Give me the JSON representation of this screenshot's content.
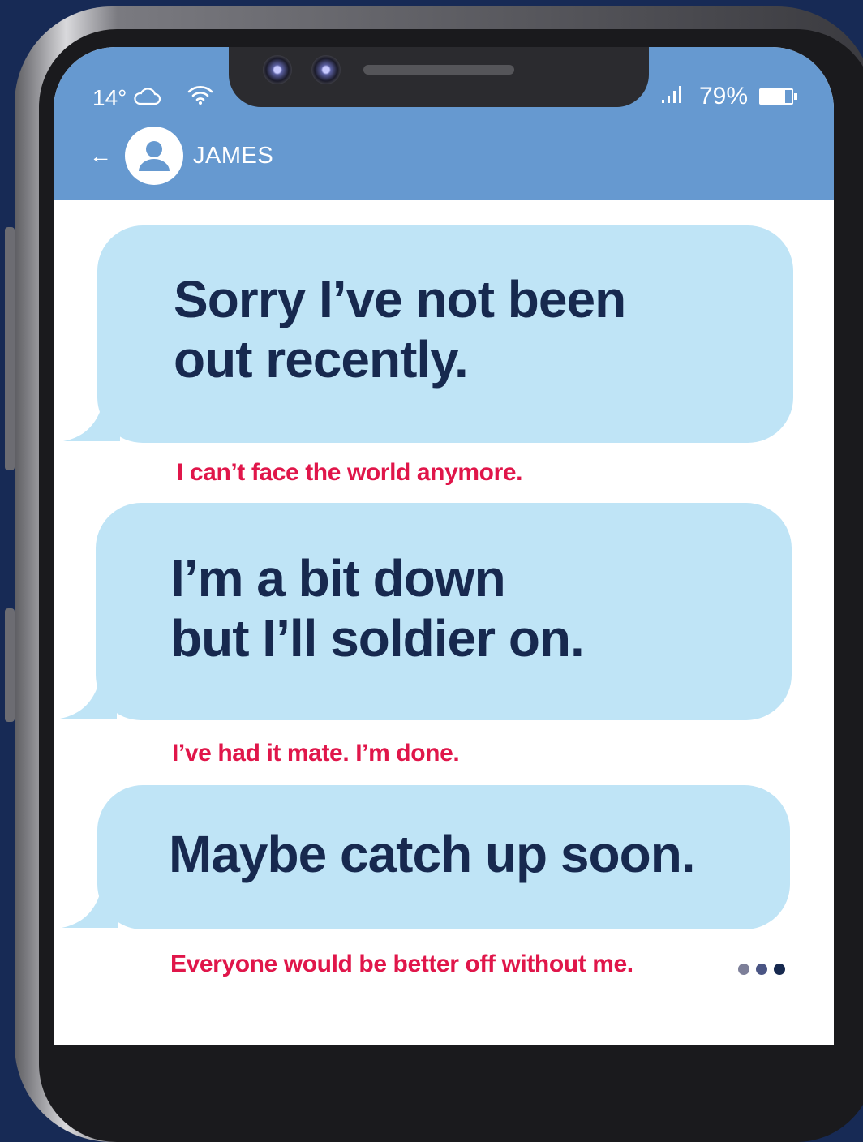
{
  "status": {
    "temperature": "14°",
    "weather_icon": "cloud-icon",
    "wifi_icon": "wifi-icon",
    "signal_icon": "signal-bars-icon",
    "battery_percent": "79%",
    "battery_level": 0.79
  },
  "header": {
    "contact_name": "JAMES",
    "back_icon": "back-arrow-icon",
    "avatar_icon": "user-avatar-icon"
  },
  "messages": [
    {
      "line1": "Sorry I’ve not been",
      "line2": "out recently.",
      "hidden_meaning": "I can’t face the world anymore."
    },
    {
      "line1": "I’m a bit down",
      "line2": "but I’ll soldier on.",
      "hidden_meaning": "I’ve had it mate. I’m done."
    },
    {
      "line1": "Maybe catch up soon.",
      "hidden_meaning": "Everyone would be better off without me."
    }
  ],
  "colors": {
    "header_bg": "#6699d0",
    "bubble_bg": "#bfe4f6",
    "message_text": "#17294f",
    "hidden_text": "#e0164a",
    "background": "#172a55"
  }
}
